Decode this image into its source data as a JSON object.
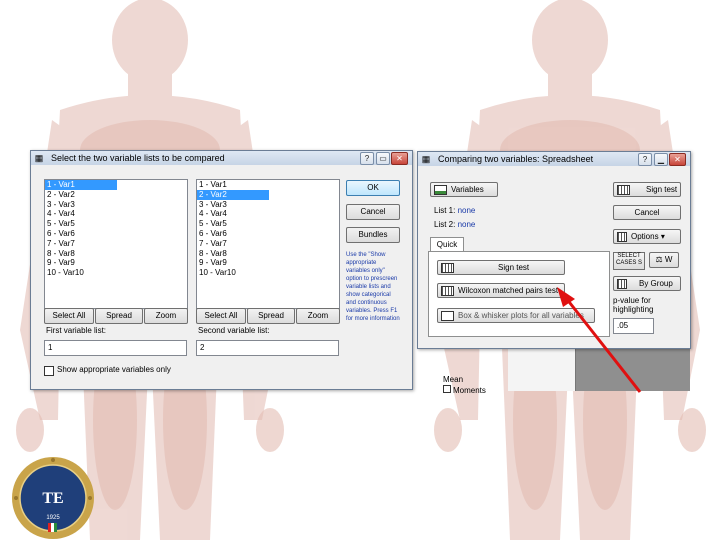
{
  "dialog_select": {
    "title": "Select the two variable lists to be compared",
    "list1": [
      "1 - Var1",
      "2 - Var2",
      "3 - Var3",
      "4 - Var4",
      "5 - Var5",
      "6 - Var6",
      "7 - Var7",
      "8 - Var8",
      "9 - Var9",
      "10 - Var10"
    ],
    "list2": [
      "1 - Var1",
      "2 - Var2",
      "3 - Var3",
      "4 - Var4",
      "5 - Var5",
      "6 - Var6",
      "7 - Var7",
      "8 - Var8",
      "9 - Var9",
      "10 - Var10"
    ],
    "list1_selected": "1 - Var1",
    "list2_selected": "2 - Var2",
    "select_all_label": "Select All",
    "spread_label": "Spread",
    "zoom_label": "Zoom",
    "first_list_label": "First variable list:",
    "first_list_value": "1",
    "second_list_label": "Second variable list:",
    "second_list_value": "2",
    "ok_label": "OK",
    "cancel_label": "Cancel",
    "bundles_label": "Bundles",
    "help_text": "Use the \"Show appropriate variables only\" option to prescreen variable lists and show categorical and continuous variables. Press F1 for more information",
    "show_appropriate_label": "Show appropriate variables only"
  },
  "dialog_compare": {
    "title": "Comparing two variables: Spreadsheet",
    "variables_label": "Variables",
    "list1_label": "List 1:",
    "list1_value": "none",
    "list2_label": "List 2:",
    "list2_value": "none",
    "tab_quick": "Quick",
    "sign_test_label": "Sign test",
    "wilcoxon_label": "Wilcoxon matched pairs test",
    "boxplot_label": "Box & whisker plots for all variables",
    "side_sign_test_label": "Sign test",
    "cancel_label": "Cancel",
    "options_label": "Options",
    "select_cases_label": "SELECT CASES",
    "s_label": "S",
    "w_label": "W",
    "by_group_label": "By Group",
    "p_value_label": "p-value for highlighting",
    "p_value": ".05"
  },
  "background_sheet": {
    "items": [
      "Mean",
      "Moments"
    ]
  },
  "logo": {
    "initials": "TE",
    "year": "1925"
  },
  "colors": {
    "selection": "#3399ff",
    "arrow": "#e01010",
    "logo_gold": "#c9a44a",
    "logo_blue": "#1f3f7a"
  }
}
